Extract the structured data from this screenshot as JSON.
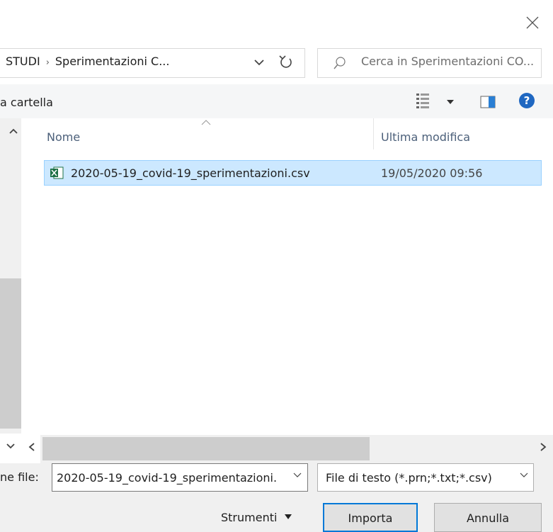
{
  "dialog": {
    "breadcrumb": {
      "root": "STUDI",
      "separator": "›",
      "current": "Sperimentazioni C..."
    },
    "search_placeholder": "Cerca in Sperimentazioni CO...",
    "toolbar": {
      "new_folder_label": "a cartella"
    },
    "columns": {
      "name": "Nome",
      "modified": "Ultima modifica"
    },
    "files": [
      {
        "name": "2020-05-19_covid-19_sperimentazioni.csv",
        "modified": "19/05/2020 09:56",
        "icon": "excel-csv-icon"
      }
    ],
    "footer": {
      "filename_label": "ne file:",
      "filename_value": "2020-05-19_covid-19_sperimentazioni.",
      "filetype_value": "File di testo (*.prn;*.txt;*.csv)",
      "tools_label": "Strumenti",
      "import_label": "Importa",
      "cancel_label": "Annulla"
    },
    "colors": {
      "selection": "#cce8ff",
      "accent": "#0078d7",
      "help": "#1f67c1"
    }
  }
}
